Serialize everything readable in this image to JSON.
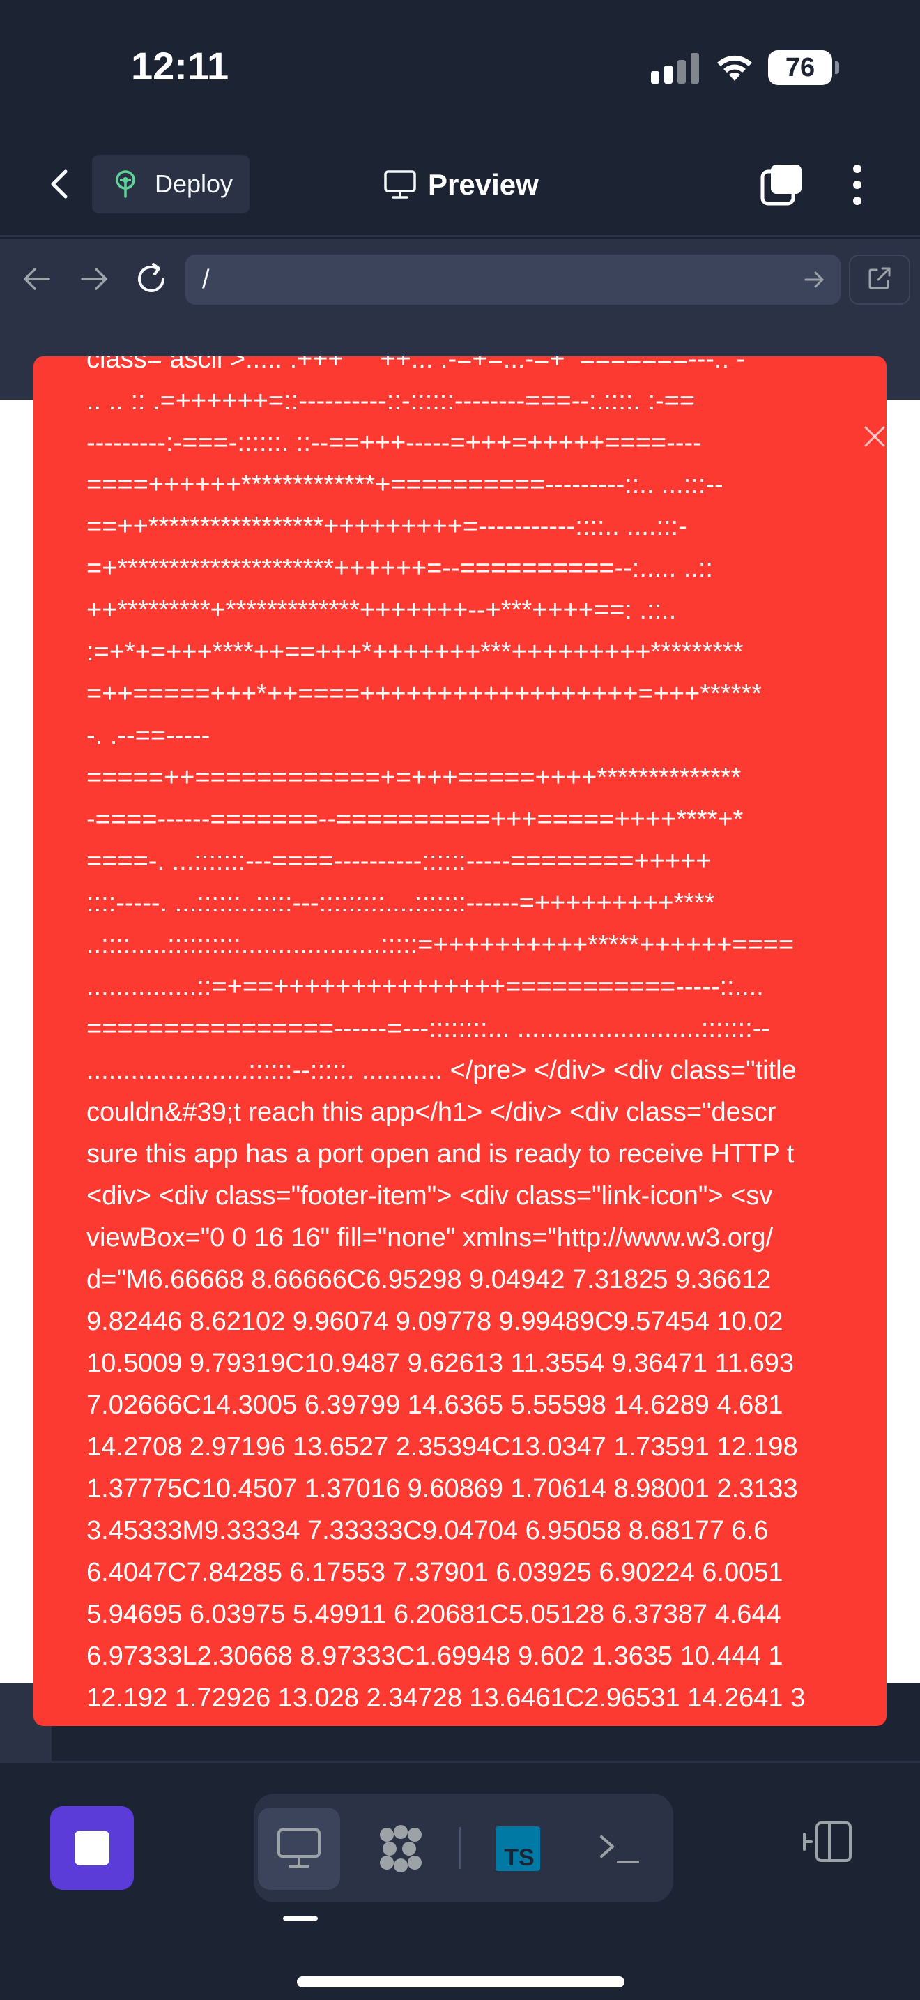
{
  "status_bar": {
    "time": "12:11",
    "battery": "76"
  },
  "header": {
    "deploy_label": "Deploy",
    "preview_label": "Preview"
  },
  "urlbar": {
    "url": "/"
  },
  "error_page": {
    "lines": [
      "class= ascii >..... .+++     ++... .-=+=...-=+  =======---:. -",
      ".. .. :: .=++++++=::----------::-::::::--------===--:.::::. :-==",
      "---------:-===-::::::. ::--==+++-----=+++=+++++====----",
      "====++++++*************+==========---------::.. ...:::--",
      "==++*****************+++++++++=-----------::::.. ....:::-",
      "=+*********************++++++=--==========--:..... ..::",
      "++*********+*************+++++++--+***++++==: .::..",
      ":=+*+=+++****++==+++*+++++++***+++++++++*********",
      "=++=====+++*++====++++++++++++++++++=+++******",
      "-. .--==-----",
      "=====++============+=+++=====++++**************",
      "-====------=======--==========+++=====++++****+*",
      "====-. ...:::::::---====----------::::::-----========+++++",
      "::::-----. ...::::::..:::::---:::::::::....:::::::------=+++++++++****",
      "..::::.....::::::::::...................:::::=++++++++++*****++++++====",
      "...............::=+==+++++++++++++++===========-----::....",
      "================------=---::::::::... .........................:::::::--",
      "......................::::::--:::::. ........... </pre> </div> <div class=\"title",
      "couldn&#39;t reach this app</h1> </div> <div class=\"descr",
      "sure this app has a port open and is ready to receive HTTP t",
      "<div> <div class=\"footer-item\"> <div class=\"link-icon\"> <sv",
      "viewBox=\"0 0 16 16\" fill=\"none\" xmlns=\"http://www.w3.org/",
      "d=\"M6.66668 8.66666C6.95298 9.04942 7.31825 9.36612",
      "9.82446 8.62102 9.96074 9.09778 9.99489C9.57454 10.02",
      "10.5009 9.79319C10.9487 9.62613 11.3554 9.36471 11.693",
      "7.02666C14.3005 6.39799 14.6365 5.55598 14.6289 4.681",
      "14.2708 2.97196 13.6527 2.35394C13.0347 1.73591 12.198",
      "1.37775C10.4507 1.37016 9.60869 1.70614 8.98001 2.3133",
      "3.45333M9.33334 7.33333C9.04704 6.95058 8.68177 6.6",
      "6.4047C7.84285 6.17553 7.37901 6.03925 6.90224 6.0051",
      "5.94695 6.03975 5.49911 6.20681C5.05128 6.37387 4.644",
      "6.97333L2.30668 8.97333C1.69948 9.602 1.3635 10.444 1",
      "12.192 1.72926 13.028 2.34728 13.6461C2.96531 14.2641 3"
    ]
  },
  "toolbar": {
    "tools": [
      {
        "name": "desktop-icon",
        "active": true
      },
      {
        "name": "ai-agent-icon",
        "active": false
      },
      {
        "name": "typescript-file-icon",
        "label": "TS",
        "active": false
      },
      {
        "name": "terminal-icon",
        "label": ">_",
        "active": false
      }
    ]
  }
}
